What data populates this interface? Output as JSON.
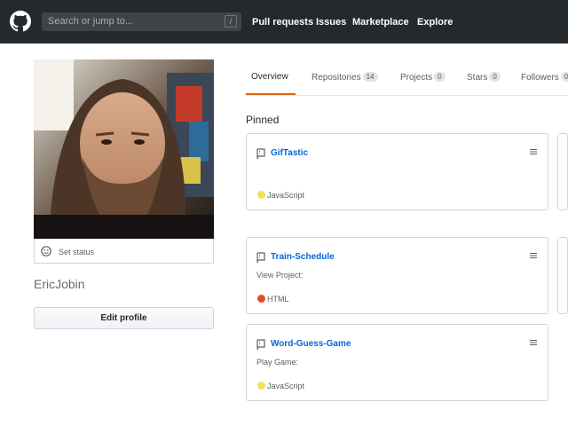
{
  "header": {
    "search_placeholder": "Search or jump to...",
    "search_shortcut": "/",
    "nav": [
      "Pull requests",
      "Issues",
      "Marketplace",
      "Explore"
    ]
  },
  "profile": {
    "set_status": "Set status",
    "username": "EricJobin",
    "edit_profile": "Edit profile"
  },
  "tabs": [
    {
      "label": "Overview",
      "count": ""
    },
    {
      "label": "Repositories",
      "count": "14"
    },
    {
      "label": "Projects",
      "count": "0"
    },
    {
      "label": "Stars",
      "count": "0"
    },
    {
      "label": "Followers",
      "count": "0"
    }
  ],
  "pinned": {
    "title": "Pinned",
    "repos": [
      {
        "name": "GifTastic",
        "description": "",
        "language": "JavaScript",
        "language_color": "#f1e05a"
      },
      {
        "name": "Train-Schedule",
        "description": "View Project:",
        "language": "HTML",
        "language_color": "#e34c26"
      },
      {
        "name": "Word-Guess-Game",
        "description": "Play Game:",
        "language": "JavaScript",
        "language_color": "#f1e05a"
      }
    ]
  },
  "colors": {
    "header_bg": "#24292e",
    "link": "#0366d6",
    "tab_accent": "#e36209"
  }
}
